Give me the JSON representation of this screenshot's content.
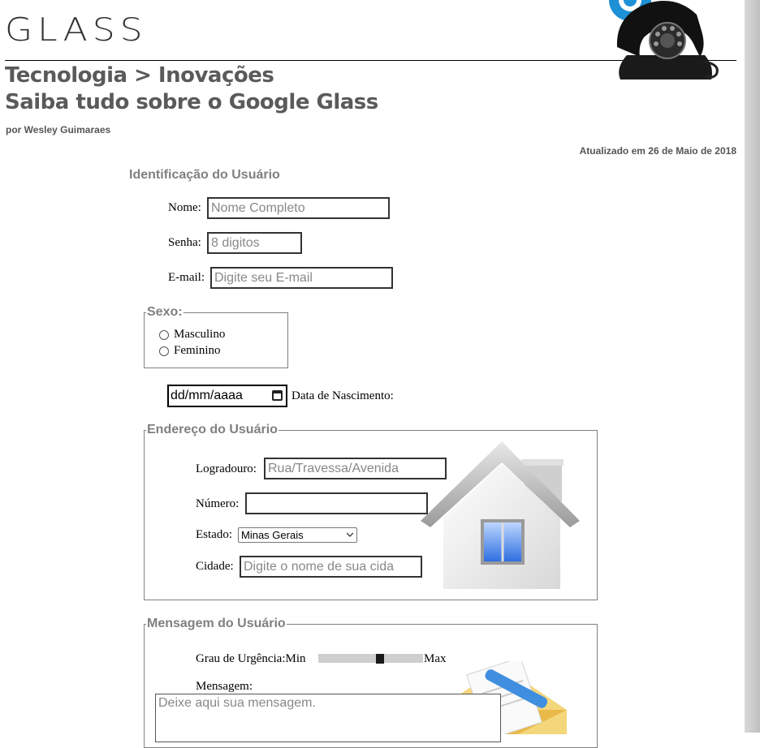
{
  "site": {
    "logo": "GLASS",
    "breadcrumb": "Tecnologia > Inovações",
    "headline": "Saiba tudo sobre o Google Glass",
    "byline": "por Wesley Guimaraes",
    "updated": "Atualizado em 26 de Maio de 2018"
  },
  "identification": {
    "title": "Identificação do Usuário",
    "nome_label": "Nome:",
    "nome_placeholder": "Nome Completo",
    "senha_label": "Senha:",
    "senha_placeholder": "8 digitos",
    "email_label": "E-mail:",
    "email_placeholder": "Digite seu E-mail"
  },
  "sexo": {
    "legend": "Sexo:",
    "options": [
      "Masculino",
      "Feminino"
    ]
  },
  "birth": {
    "placeholder": "dd/mm/aaaa",
    "label": "Data de Nascimento:"
  },
  "address": {
    "legend": "Endereço do Usuário",
    "logradouro_label": "Logradouro:",
    "logradouro_placeholder": "Rua/Travessa/Avenida",
    "numero_label": "Número:",
    "estado_label": "Estado:",
    "estado_value": "Minas Gerais",
    "cidade_label": "Cidade:",
    "cidade_placeholder": "Digite o nome de sua cida"
  },
  "message": {
    "legend": "Mensagem do Usuário",
    "urgency_label": "Grau de Urgência:Min",
    "urgency_max": "Max",
    "urgency_level": 0.6,
    "message_label": "Mensagem:",
    "message_placeholder": "Deixe aqui sua mensagem."
  },
  "icons": {
    "phone": "telephone-at-icon",
    "house": "house-icon",
    "mail": "envelope-icon"
  }
}
